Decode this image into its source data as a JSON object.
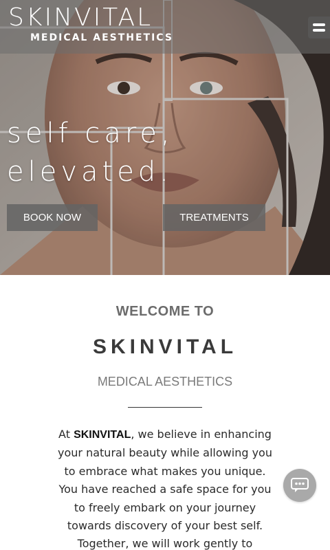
{
  "header": {
    "logo_main": "SKINVITAL",
    "logo_sub": "MEDICAL AESTHETICS",
    "menu_icon": "hamburger-menu-icon"
  },
  "hero": {
    "tagline_line1": "self care,",
    "tagline_line2": "elevated.",
    "book_button": "BOOK NOW",
    "treatments_button": "TREATMENTS"
  },
  "welcome": {
    "heading": "WELCOME TO",
    "brand": "SKINVITAL",
    "subtitle": "MEDICAL AESTHETICS",
    "intro_prefix": "At ",
    "intro_brand": "SKINVITAL",
    "intro_rest": ", we believe in enhancing your natural beauty while allowing you to embrace what makes you unique. You have reached a safe space for you to freely embark on your journey towards discovery of your best self. Together, we will work gently to"
  },
  "chat": {
    "icon": "chat-bubble-icon"
  },
  "colors": {
    "header_bg": "#6e6e6e",
    "button_bg": "#646464",
    "heading_gray": "#6b6b6b",
    "brand_dark": "#3a3a3a",
    "chat_bg": "#a9a9a9"
  }
}
